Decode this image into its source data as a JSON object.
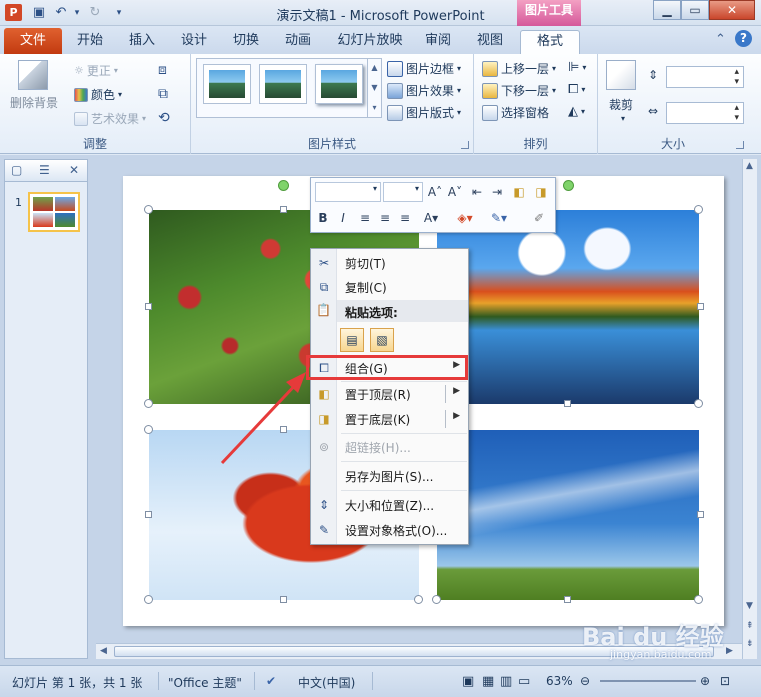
{
  "window": {
    "title": "演示文稿1 - Microsoft PowerPoint",
    "app_letter": "P",
    "context_tab_group": "图片工具",
    "minimize": "▁",
    "restore": "▭",
    "close": "✕"
  },
  "tabs": {
    "file": "文件",
    "items": [
      "开始",
      "插入",
      "设计",
      "切换",
      "动画",
      "幻灯片放映",
      "审阅",
      "视图",
      "格式"
    ],
    "active": "格式"
  },
  "ribbon": {
    "adjust": {
      "remove_bg": "删除背景",
      "corrections": "更正",
      "color": "颜色",
      "artistic": "艺术效果",
      "label": "调整"
    },
    "picture_styles": {
      "border": "图片边框",
      "effects": "图片效果",
      "layout": "图片版式",
      "label": "图片样式"
    },
    "arrange": {
      "bring_forward": "上移一层",
      "send_backward": "下移一层",
      "selection_pane": "选择窗格",
      "label": "排列"
    },
    "size": {
      "crop": "裁剪",
      "label": "大小"
    }
  },
  "thumbnails": {
    "slide_number": "1"
  },
  "context_menu": {
    "items": [
      {
        "label": "剪切(T)",
        "icon": "scissors-icon"
      },
      {
        "label": "复制(C)",
        "icon": "copy-icon"
      },
      {
        "label": "粘贴选项:",
        "icon": "paste-icon"
      },
      {
        "label": "组合(G)",
        "icon": "group-icon"
      },
      {
        "label": "置于顶层(R)",
        "icon": "bring-to-front-icon"
      },
      {
        "label": "置于底层(K)",
        "icon": "send-to-back-icon"
      },
      {
        "label": "超链接(H)...",
        "icon": "hyperlink-icon"
      },
      {
        "label": "另存为图片(S)...",
        "icon": "save-as-picture-icon"
      },
      {
        "label": "大小和位置(Z)...",
        "icon": "size-position-icon"
      },
      {
        "label": "设置对象格式(O)...",
        "icon": "format-object-icon"
      }
    ]
  },
  "status": {
    "slide_info": "幻灯片 第 1 张，共 1 张",
    "theme": "\"Office 主题\"",
    "language": "中文(中国)",
    "zoom": "63%"
  },
  "watermark": {
    "brand": "Bai du 经验",
    "url": "jingyan.baidu.com"
  },
  "colors": {
    "file_tab": "#c23a10",
    "context_tab": "#d5589a",
    "highlight": "#e63a3a"
  }
}
